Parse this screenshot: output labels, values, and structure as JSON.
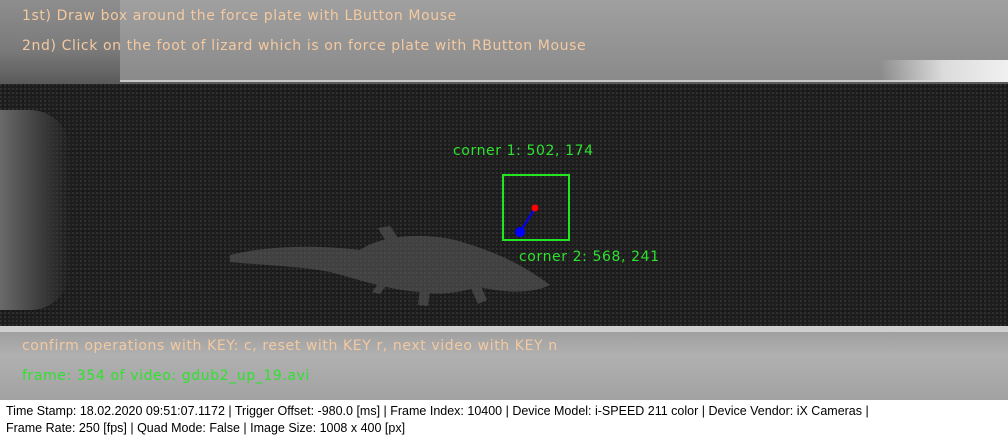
{
  "overlay": {
    "instruction_1": "1st) Draw box around the force plate with LButton Mouse",
    "instruction_2": "2nd) Click on the foot of lizard which is on force plate with RButton Mouse",
    "corner_1_label": "corner 1: 502, 174",
    "corner_2_label": "corner 2: 568, 241",
    "confirm_hint": "confirm operations with KEY: c, reset with KEY r, next video with KEY n",
    "frame_info": "frame: 354 of video: gdub2_up_19.avi"
  },
  "markers": {
    "box_color": "#22e622",
    "foot_point_color": "#ff0000",
    "origin_point_color": "#0000ff",
    "connector_color": "#0000ff"
  },
  "status_bar": {
    "line_1": "Time Stamp: 18.02.2020 09:51:07.1172  |  Trigger Offset: -980.0 [ms]  |  Frame Index: 10400  |  Device Model: i-SPEED 211 color  |  Device Vendor: iX Cameras  |",
    "line_2": "Frame Rate: 250 [fps]  |  Quad Mode: False  |  Image Size: 1008 x 400 [px]"
  }
}
